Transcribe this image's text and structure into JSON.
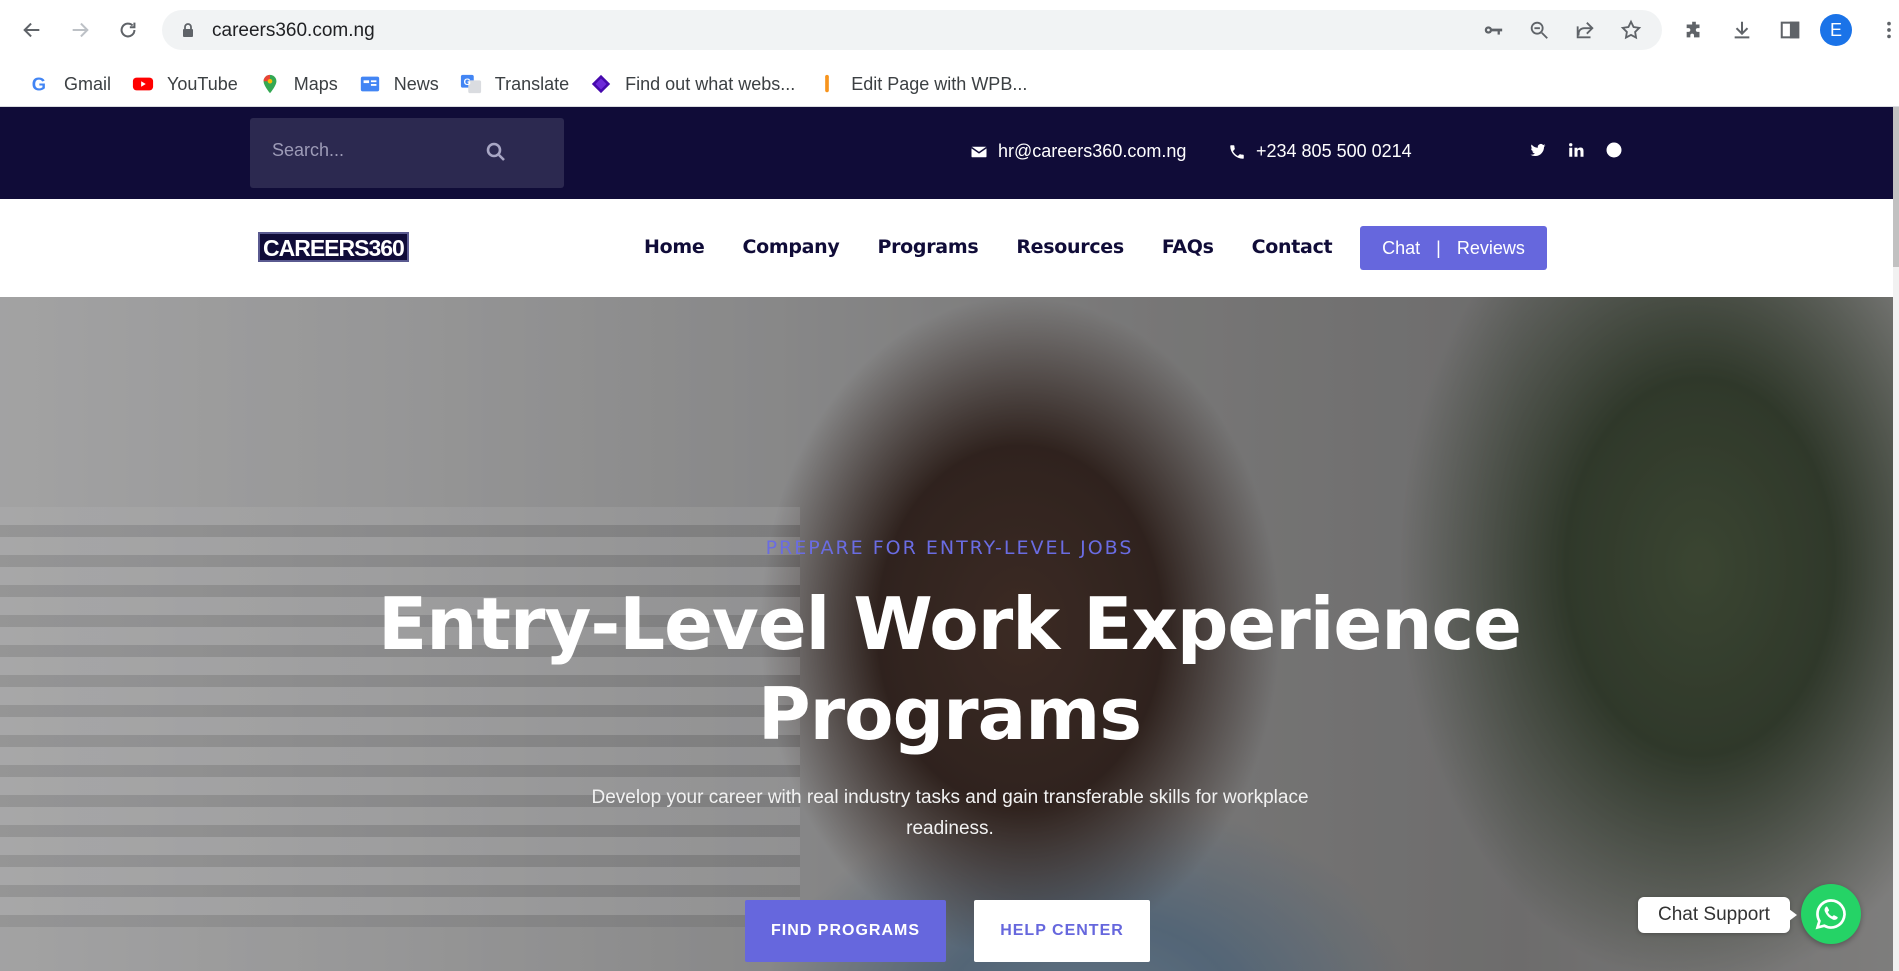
{
  "browser": {
    "url": "careers360.com.ng",
    "profile_initial": "E",
    "bookmarks": [
      {
        "label": "Gmail",
        "icon": "gmail-icon"
      },
      {
        "label": "YouTube",
        "icon": "youtube-icon"
      },
      {
        "label": "Maps",
        "icon": "maps-icon"
      },
      {
        "label": "News",
        "icon": "news-icon"
      },
      {
        "label": "Translate",
        "icon": "translate-icon"
      },
      {
        "label": "Find out what webs...",
        "icon": "wappalyzer-icon"
      },
      {
        "label": "Edit Page with WPB...",
        "icon": "wpbakery-icon"
      }
    ]
  },
  "topbar": {
    "search_placeholder": "Search...",
    "email": "hr@careers360.com.ng",
    "phone": "+234 805 500 0214",
    "socials": [
      "twitter-icon",
      "linkedin-icon",
      "dribbble-icon"
    ]
  },
  "nav": {
    "logo": "CAREERS360",
    "links": [
      "Home",
      "Company",
      "Programs",
      "Resources",
      "FAQs",
      "Contact"
    ],
    "cta_chat": "Chat",
    "cta_separator": "|",
    "cta_reviews": "Reviews"
  },
  "hero": {
    "eyebrow": "PREPARE FOR ENTRY-LEVEL JOBS",
    "title_line1": "Entry-Level Work Experience",
    "title_line2": "Programs",
    "description": "Develop your career with real industry tasks and gain transferable skills for workplace readiness.",
    "primary_button": "FIND PROGRAMS",
    "secondary_button": "HELP CENTER"
  },
  "widgets": {
    "chat_support": "Chat Support"
  },
  "colors": {
    "topbar_bg": "#100c38",
    "accent": "#6667dd",
    "whatsapp": "#25d366"
  }
}
